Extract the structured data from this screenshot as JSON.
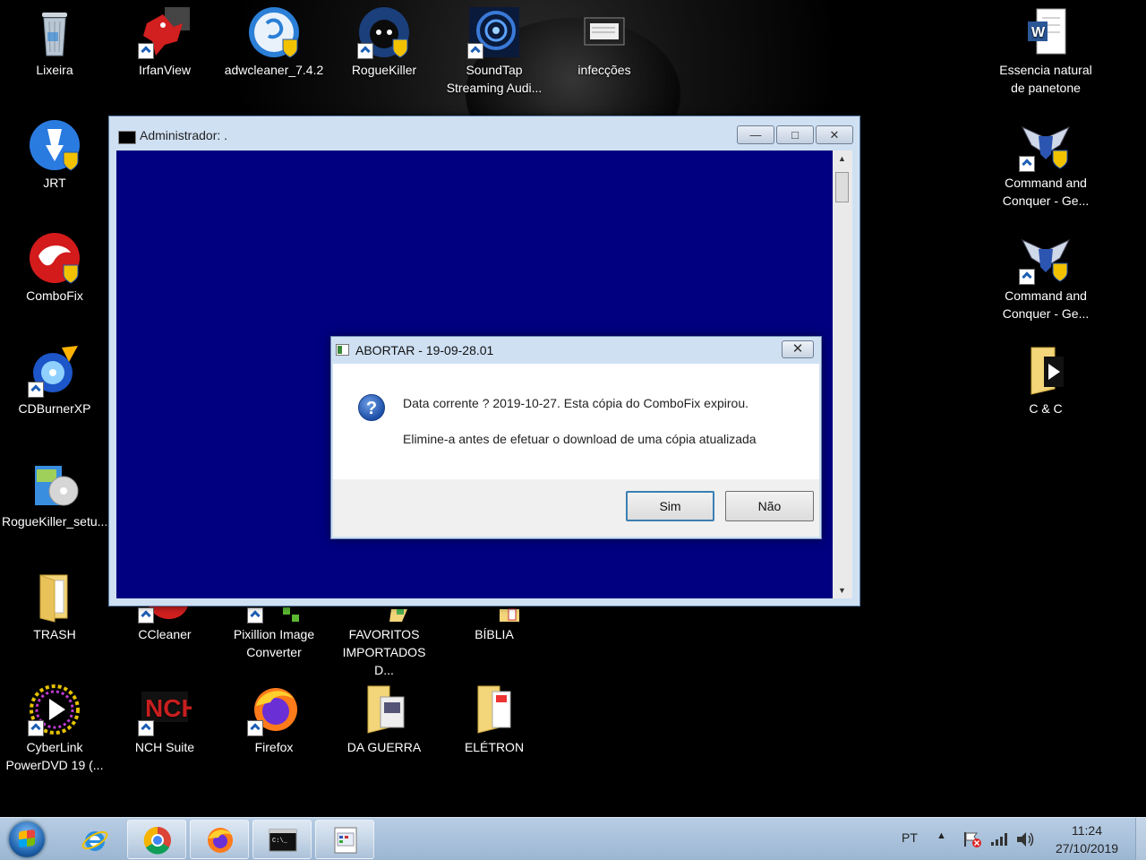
{
  "desktop_icons_left": [
    {
      "label": "Lixeira",
      "icon": "recycle-bin-icon"
    },
    {
      "label": "IrfanView",
      "icon": "irfanview-icon"
    },
    {
      "label": "adwcleaner_7.4.2",
      "icon": "adwcleaner-icon"
    },
    {
      "label": "RogueKiller",
      "icon": "roguekiller-icon"
    },
    {
      "label": "SoundTap Streaming Audi...",
      "icon": "soundtap-icon"
    },
    {
      "label": "infecções",
      "icon": "document-icon"
    },
    {
      "label": "JRT",
      "icon": "jrt-icon"
    },
    {
      "label": "ComboFix",
      "icon": "combofix-icon"
    },
    {
      "label": "CDBurnerXP",
      "icon": "cdburnerxp-icon"
    },
    {
      "label": "RogueKiller_setu...",
      "icon": "installer-icon"
    },
    {
      "label": "TRASH",
      "icon": "folder-icon"
    },
    {
      "label": "CCleaner",
      "icon": "ccleaner-icon"
    },
    {
      "label": "Pixillion Image Converter",
      "icon": "pixillion-icon"
    },
    {
      "label": "FAVORITOS IMPORTADOS D...",
      "icon": "folder-icon"
    },
    {
      "label": "BÍBLIA",
      "icon": "folder-icon"
    },
    {
      "label": "CyberLink PowerDVD 19 (...",
      "icon": "powerdvd-icon"
    },
    {
      "label": "NCH Suite",
      "icon": "nch-icon"
    },
    {
      "label": "Firefox",
      "icon": "firefox-icon"
    },
    {
      "label": "DA GUERRA",
      "icon": "folder-icon"
    },
    {
      "label": "ELÉTRON",
      "icon": "folder-icon"
    }
  ],
  "desktop_icons_right": [
    {
      "label": "Essencia natural de panetone",
      "icon": "word-doc-icon"
    },
    {
      "label": "Command and Conquer - Ge...",
      "icon": "cnc-icon"
    },
    {
      "label": "Command and Conquer - Ge...",
      "icon": "cnc-icon"
    },
    {
      "label": "C & C",
      "icon": "folder-icon"
    }
  ],
  "console": {
    "title": "Administrador:  .",
    "minimize": "—",
    "maximize": "□",
    "close": "✕",
    "bg_color": "#000080"
  },
  "dialog": {
    "title": "ABORTAR - 19-09-28.01",
    "close": "✕",
    "message_line1": "Data corrente ? 2019-10-27. Esta cópia do ComboFix expirou.",
    "message_line2": "Elimine-a antes de efetuar o download de uma cópia atualizada",
    "question_glyph": "?",
    "yes_label": "Sim",
    "no_label": "Não"
  },
  "taskbar": {
    "pinned": [
      "internet-explorer-icon",
      "chrome-icon",
      "firefox-icon",
      "console-icon",
      "combofix-window-icon"
    ],
    "language": "PT",
    "time": "11:24",
    "date": "27/10/2019"
  }
}
